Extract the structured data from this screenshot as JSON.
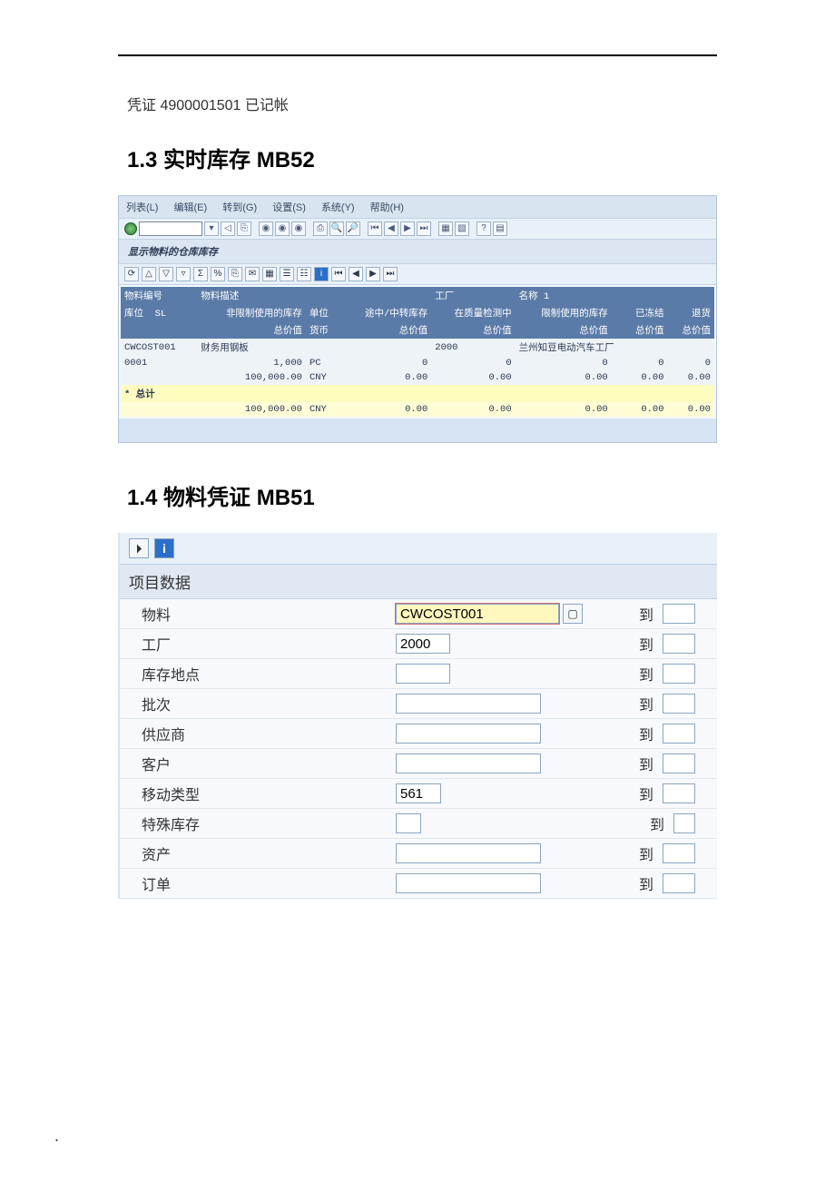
{
  "doc": {
    "posted_note": "凭证 4900001501 已记帐",
    "section_1_3": "1.3   实时库存 MB52",
    "section_1_4": "1.4  物料凭证  MB51"
  },
  "mb52": {
    "menu": {
      "list": "列表(L)",
      "edit": "编辑(E)",
      "goto": "转到(G)",
      "settings": "设置(S)",
      "system": "系统(Y)",
      "help": "帮助(H)"
    },
    "title": "显示物料的仓库库存",
    "headers": {
      "material_no": "物料编号",
      "material_desc": "物料描述",
      "plant": "工厂",
      "name1": "名称 1",
      "sloc": "库位",
      "sl": "SL",
      "unrestricted": "非限制使用的库存",
      "unit": "单位",
      "transit": "途中/中转库存",
      "qi": "在质量检测中",
      "restricted": "限制使用的库存",
      "blocked": "已冻结",
      "returns": "退货",
      "total_value": "总价值",
      "currency": "货币"
    },
    "rows": [
      {
        "material": "CWCOST001",
        "desc": "财务用钢板",
        "plant": "2000",
        "plant_name": "兰州知豆电动汽车工厂",
        "sloc": "0001",
        "qty": "1,000",
        "uom": "PC",
        "transit": "0",
        "qi": "0",
        "restricted": "0",
        "blocked": "0",
        "returns": "0",
        "value": "100,000.00",
        "curr": "CNY",
        "v_transit": "0.00",
        "v_qi": "0.00",
        "v_restricted": "0.00",
        "v_blocked": "0.00",
        "v_returns": "0.00"
      }
    ],
    "total_label": "* 总计",
    "totals": {
      "value": "100,000.00",
      "curr": "CNY",
      "v_transit": "0.00",
      "v_qi": "0.00",
      "v_restricted": "0.00",
      "v_blocked": "0.00",
      "v_returns": "0.00"
    }
  },
  "mb51": {
    "panel_title": "项目数据",
    "to_label": "到",
    "fields": {
      "material_lbl": "物料",
      "material_val": "CWCOST001",
      "plant_lbl": "工厂",
      "plant_val": "2000",
      "sloc_lbl": "库存地点",
      "sloc_val": "",
      "batch_lbl": "批次",
      "batch_val": "",
      "vendor_lbl": "供应商",
      "vendor_val": "",
      "customer_lbl": "客户",
      "customer_val": "",
      "mvt_lbl": "移动类型",
      "mvt_val": "561",
      "special_lbl": "特殊库存",
      "special_val": "",
      "asset_lbl": "资产",
      "asset_val": "",
      "order_lbl": "订单",
      "order_val": ""
    }
  }
}
